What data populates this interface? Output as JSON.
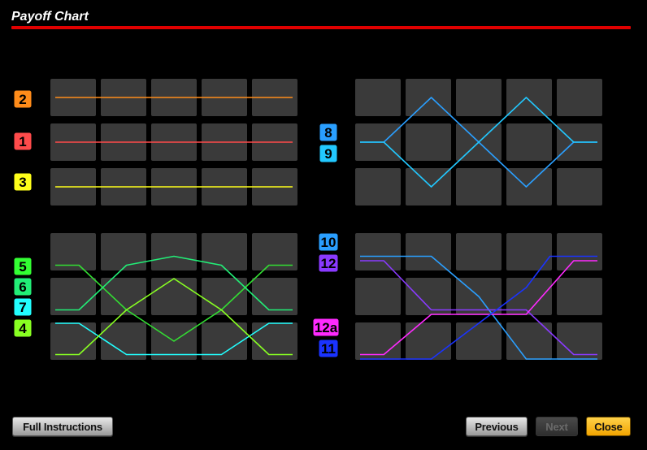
{
  "title": "Payoff Chart",
  "colors": {
    "title_bar": "#e00000",
    "cell": "#3a3a3a",
    "background": "#000000"
  },
  "buttons": {
    "full_instructions": "Full Instructions",
    "previous": "Previous",
    "next": "Next",
    "close": "Close"
  },
  "panels": [
    {
      "id": "top-left",
      "badges": [
        {
          "label": "2",
          "color": "#ff8c1a"
        },
        {
          "label": "1",
          "color": "#ff4b4b"
        },
        {
          "label": "3",
          "color": "#ffff1a"
        }
      ],
      "lines": [
        {
          "label": "2",
          "color": "#ff8c1a",
          "path": [
            [
              0,
              0
            ],
            [
              5,
              0
            ]
          ]
        },
        {
          "label": "1",
          "color": "#ff4b4b",
          "path": [
            [
              0,
              1
            ],
            [
              5,
              1
            ]
          ]
        },
        {
          "label": "3",
          "color": "#ffff1a",
          "path": [
            [
              0,
              2
            ],
            [
              5,
              2
            ]
          ]
        }
      ]
    },
    {
      "id": "top-right",
      "badges": [
        {
          "label": "8",
          "color": "#2a9fff"
        },
        {
          "label": "9",
          "color": "#22c8ff"
        }
      ],
      "lines": [
        {
          "label": "8",
          "color": "#2a9fff",
          "path": [
            [
              0,
              1
            ],
            [
              0.5,
              1
            ],
            [
              1.5,
              0
            ],
            [
              2.5,
              1
            ],
            [
              3.5,
              2
            ],
            [
              4.5,
              1
            ],
            [
              5,
              1
            ]
          ]
        },
        {
          "label": "9",
          "color": "#22c8ff",
          "path": [
            [
              0,
              1
            ],
            [
              0.5,
              1
            ],
            [
              1.5,
              2
            ],
            [
              2.5,
              1
            ],
            [
              3.5,
              0
            ],
            [
              4.5,
              1
            ],
            [
              5,
              1
            ]
          ]
        }
      ]
    },
    {
      "id": "bottom-left",
      "badges": [
        {
          "label": "5",
          "color": "#33ff33"
        },
        {
          "label": "6",
          "color": "#22ee77"
        },
        {
          "label": "7",
          "color": "#22ffff"
        },
        {
          "label": "4",
          "color": "#88ff22"
        }
      ],
      "lines": [
        {
          "label": "5",
          "color": "#33dd33",
          "path": [
            [
              0,
              0.3
            ],
            [
              0.5,
              0.3
            ],
            [
              1.5,
              1.3
            ],
            [
              2.5,
              2
            ],
            [
              3.5,
              1.3
            ],
            [
              4.5,
              0.3
            ],
            [
              5,
              0.3
            ]
          ]
        },
        {
          "label": "6",
          "color": "#22ee77",
          "path": [
            [
              0,
              1.3
            ],
            [
              0.5,
              1.3
            ],
            [
              1.5,
              0.3
            ],
            [
              2.5,
              0.1
            ],
            [
              3.5,
              0.3
            ],
            [
              4.5,
              1.3
            ],
            [
              5,
              1.3
            ]
          ]
        },
        {
          "label": "7",
          "color": "#22ffff",
          "path": [
            [
              0,
              1.6
            ],
            [
              0.5,
              1.6
            ],
            [
              1.5,
              2.3
            ],
            [
              2.5,
              2.3
            ],
            [
              3.5,
              2.3
            ],
            [
              4.5,
              1.6
            ],
            [
              5,
              1.6
            ]
          ]
        },
        {
          "label": "4",
          "color": "#88ff22",
          "path": [
            [
              0,
              2.3
            ],
            [
              0.5,
              2.3
            ],
            [
              1.5,
              1.3
            ],
            [
              2.5,
              0.6
            ],
            [
              3.5,
              1.3
            ],
            [
              4.5,
              2.3
            ],
            [
              5,
              2.3
            ]
          ]
        }
      ]
    },
    {
      "id": "bottom-right",
      "badges": [
        {
          "label": "10",
          "color": "#2a9fff"
        },
        {
          "label": "12",
          "color": "#8a3aff"
        },
        {
          "label": "12a",
          "color": "#ff2aff"
        },
        {
          "label": "11",
          "color": "#1a33ff"
        }
      ],
      "lines": [
        {
          "label": "10",
          "color": "#2a9fff",
          "path": [
            [
              0,
              0.1
            ],
            [
              1.5,
              0.1
            ],
            [
              2.5,
              1
            ],
            [
              3.5,
              2.4
            ],
            [
              5,
              2.4
            ]
          ]
        },
        {
          "label": "12",
          "color": "#8a3aff",
          "path": [
            [
              0,
              0.2
            ],
            [
              0.5,
              0.2
            ],
            [
              1.5,
              1.3
            ],
            [
              3.5,
              1.3
            ],
            [
              4.5,
              2.3
            ],
            [
              5,
              2.3
            ]
          ]
        },
        {
          "label": "12a",
          "color": "#ff2aff",
          "path": [
            [
              0,
              2.3
            ],
            [
              0.5,
              2.3
            ],
            [
              1.5,
              1.4
            ],
            [
              3.5,
              1.4
            ],
            [
              4.5,
              0.2
            ],
            [
              5,
              0.2
            ]
          ]
        },
        {
          "label": "11",
          "color": "#1a33ff",
          "path": [
            [
              0,
              2.4
            ],
            [
              1.5,
              2.4
            ],
            [
              2.5,
              1.6
            ],
            [
              3.5,
              0.8
            ],
            [
              4,
              0.1
            ],
            [
              5,
              0.1
            ]
          ]
        }
      ]
    }
  ]
}
